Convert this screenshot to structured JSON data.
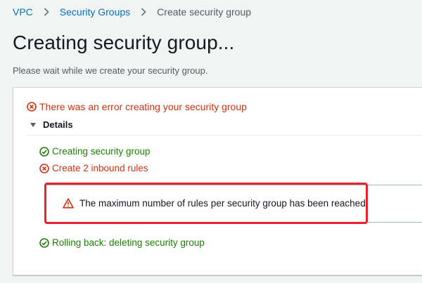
{
  "breadcrumb": {
    "items": [
      "VPC",
      "Security Groups",
      "Create security group"
    ]
  },
  "page": {
    "title": "Creating security group...",
    "subtitle": "Please wait while we create your security group."
  },
  "status": {
    "error_message": "There was an error creating your security group",
    "details_label": "Details",
    "steps": [
      {
        "label": "Creating security group",
        "state": "success"
      },
      {
        "label": "Create 2 inbound rules",
        "state": "error"
      },
      {
        "label": "Rolling back: deleting security group",
        "state": "success"
      }
    ],
    "alert": {
      "message": "The maximum number of rules per security group has been reached."
    }
  },
  "colors": {
    "link": "#0073bb",
    "error": "#d13212",
    "success": "#1d8102",
    "highlight": "#e8232f"
  },
  "icons": {
    "error": "error-circle-icon",
    "success": "success-circle-icon",
    "warning": "warning-triangle-icon",
    "caret": "caret-down-icon",
    "separator": "chevron-right-icon"
  }
}
